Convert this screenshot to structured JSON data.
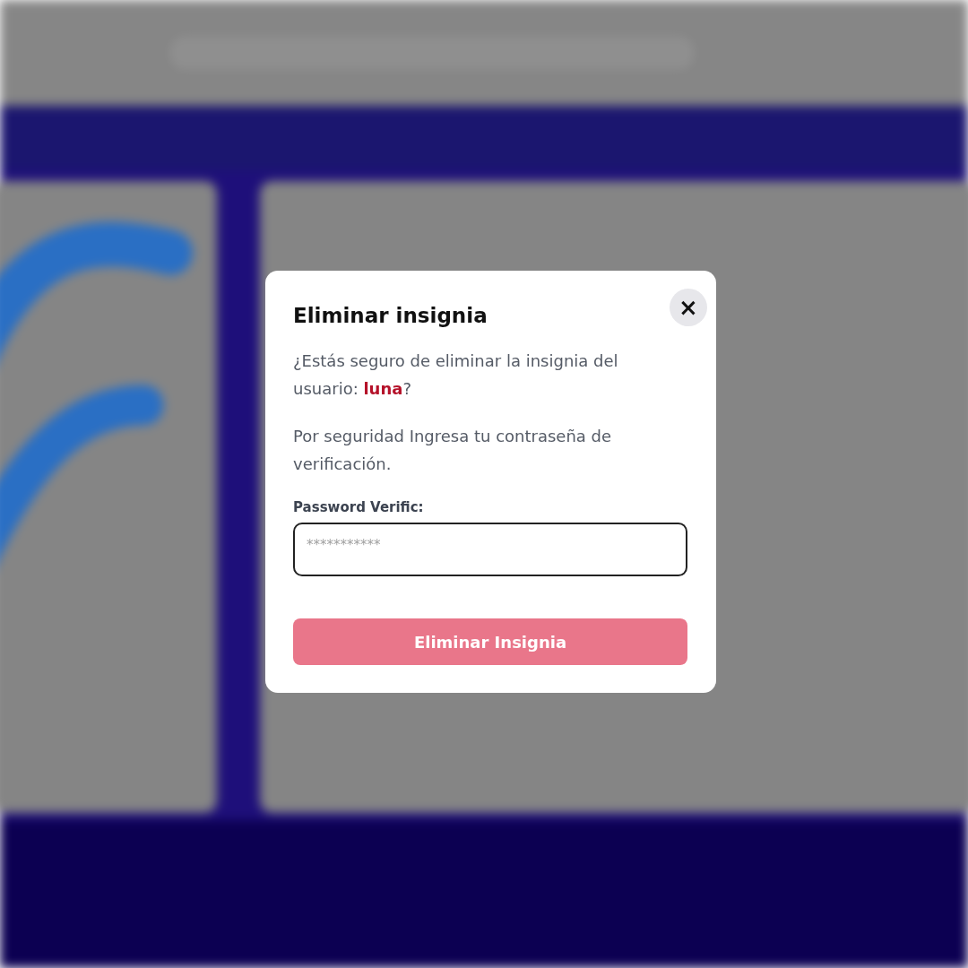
{
  "dialog": {
    "title": "Eliminar insignia",
    "close": "×",
    "message": "¿Estás seguro de eliminar la insignia del usuario: **luna**?",
    "note": "Por seguridad Ingresa tu contraseña de verificación.",
    "field": {
      "label": "Password Verific:",
      "placeholder": "***********"
    },
    "button": {
      "label": "Eliminar Insignia",
      "disabled": true
    }
  }
}
